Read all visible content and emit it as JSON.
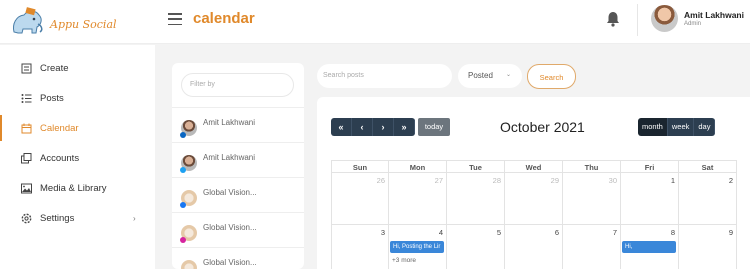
{
  "brand": {
    "name": "Appu Social",
    "accent": "#e0892b"
  },
  "header": {
    "title": "calendar",
    "menu_icon": "hamburger-icon",
    "notification_icon": "bell-icon"
  },
  "user": {
    "name": "Amit Lakhwani",
    "role": "Admin"
  },
  "sidebar": {
    "items": [
      {
        "label": "Create",
        "icon": "create-icon",
        "active": false
      },
      {
        "label": "Posts",
        "icon": "list-icon",
        "active": false
      },
      {
        "label": "Calendar",
        "icon": "calendar-icon",
        "active": true
      },
      {
        "label": "Accounts",
        "icon": "accounts-icon",
        "active": false
      },
      {
        "label": "Media & Library",
        "icon": "image-icon",
        "active": false
      },
      {
        "label": "Settings",
        "icon": "gear-icon",
        "active": false
      }
    ]
  },
  "accounts_panel": {
    "filter_placeholder": "Filter by",
    "accounts": [
      {
        "name": "Amit Lakhwani",
        "network": "linkedin"
      },
      {
        "name": "Amit Lakhwani",
        "network": "twitter"
      },
      {
        "name": "Global Vision...",
        "network": "facebook"
      },
      {
        "name": "Global Vision...",
        "network": "instagram"
      },
      {
        "name": "Global Vision...",
        "network": "linkedin"
      }
    ]
  },
  "toolbar": {
    "search_placeholder": "Search posts",
    "status_value": "Posted",
    "search_label": "Search"
  },
  "calendar": {
    "nav": [
      "«",
      "‹",
      "›",
      "»"
    ],
    "today_label": "today",
    "title": "October 2021",
    "views": [
      {
        "label": "month",
        "active": true
      },
      {
        "label": "week",
        "active": false
      },
      {
        "label": "day",
        "active": false
      }
    ],
    "weekdays": [
      "Sun",
      "Mon",
      "Tue",
      "Wed",
      "Thu",
      "Fri",
      "Sat"
    ],
    "weeks": [
      [
        {
          "d": "26",
          "muted": true
        },
        {
          "d": "27",
          "muted": true
        },
        {
          "d": "28",
          "muted": true
        },
        {
          "d": "29",
          "muted": true
        },
        {
          "d": "30",
          "muted": true
        },
        {
          "d": "1",
          "muted": false
        },
        {
          "d": "2",
          "muted": false
        }
      ],
      [
        {
          "d": "3",
          "muted": false
        },
        {
          "d": "4",
          "muted": false
        },
        {
          "d": "5",
          "muted": false
        },
        {
          "d": "6",
          "muted": false
        },
        {
          "d": "7",
          "muted": false
        },
        {
          "d": "8",
          "muted": false
        },
        {
          "d": "9",
          "muted": false
        }
      ]
    ],
    "events": [
      {
        "week": 1,
        "day": 1,
        "title": "Hi, Posting the Lir"
      },
      {
        "week": 1,
        "day": 5,
        "title": "Hi,"
      }
    ],
    "more": [
      {
        "week": 1,
        "day": 1,
        "label": "+3 more"
      }
    ],
    "event_color": "#3a87d9"
  }
}
